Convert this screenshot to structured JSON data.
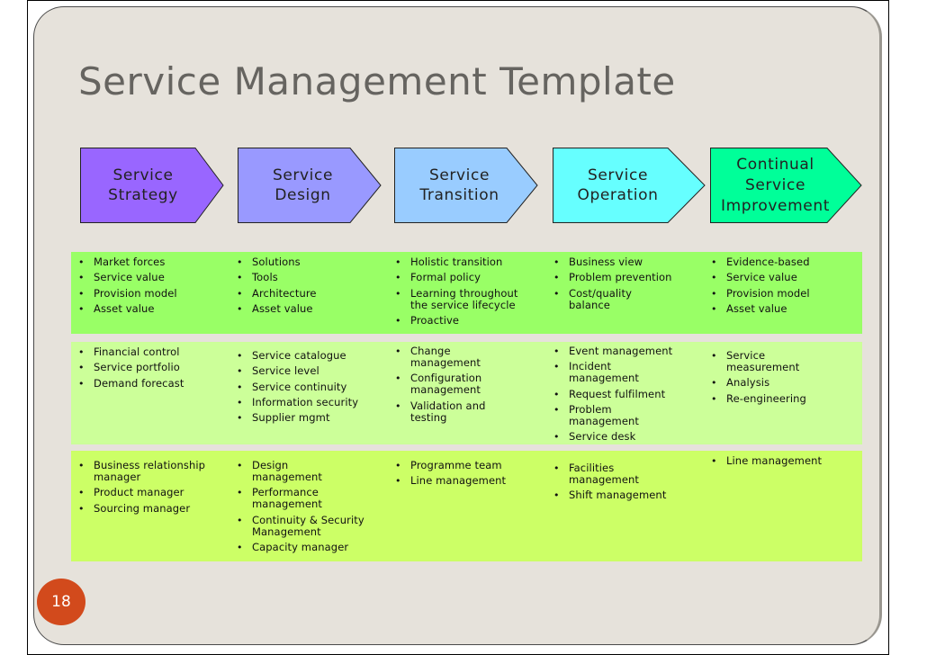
{
  "slide": {
    "title": "Service Management Template",
    "page_number": "18",
    "colors": {
      "background": "#e6e2db",
      "title_text": "#666460",
      "page_badge": "#d24a1c",
      "row1_band": "#99ff66",
      "row2_band": "#ccff99",
      "row3_band": "#ccff66"
    }
  },
  "stages": [
    {
      "line1": "Service",
      "line2": "Strategy",
      "line3": "",
      "color": "#9966ff"
    },
    {
      "line1": "Service",
      "line2": "Design",
      "line3": "",
      "color": "#9999ff"
    },
    {
      "line1": "Service",
      "line2": "Transition",
      "line3": "",
      "color": "#99ccff"
    },
    {
      "line1": "Service",
      "line2": "Operation",
      "line3": "",
      "color": "#66ffff"
    },
    {
      "line1": "Continual",
      "line2": "Service",
      "line3": "Improvement",
      "color": "#00ff99"
    }
  ],
  "rows": [
    {
      "columns": [
        [
          "Market forces",
          "Service value",
          "Provision model",
          "Asset value"
        ],
        [
          "Solutions",
          "Tools",
          "Architecture",
          "Asset value"
        ],
        [
          "Holistic transition",
          "Formal policy",
          "Learning throughout the service lifecycle",
          "Proactive"
        ],
        [
          "Business view",
          "Problem prevention",
          "Cost/quality balance"
        ],
        [
          "Evidence-based",
          "Service value",
          "Provision model",
          "Asset value"
        ]
      ]
    },
    {
      "columns": [
        [
          "Financial control",
          "Service portfolio",
          "Demand forecast"
        ],
        [
          "Service catalogue",
          "Service level",
          "Service continuity",
          "Information security",
          "Supplier mgmt"
        ],
        [
          "Change management",
          "Configuration management",
          "Validation and testing"
        ],
        [
          "Event management",
          "Incident management",
          "Request fulfilment",
          "Problem management",
          "Service desk"
        ],
        [
          "Service measurement",
          "Analysis",
          "Re-engineering"
        ]
      ]
    },
    {
      "columns": [
        [
          "Business relationship manager",
          "Product manager",
          "Sourcing manager"
        ],
        [
          "Design management",
          "Performance management",
          "Continuity & Security Management",
          "Capacity manager"
        ],
        [
          "Programme team",
          "Line management"
        ],
        [
          "Facilities management",
          "Shift management"
        ],
        [
          "Line management"
        ]
      ]
    }
  ]
}
